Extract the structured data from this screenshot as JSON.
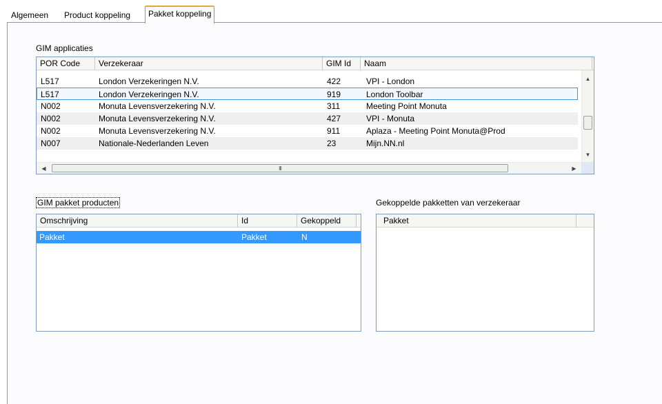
{
  "tabs": [
    {
      "label": "Algemeen"
    },
    {
      "label": "Product koppeling"
    },
    {
      "label": "Pakket koppeling"
    }
  ],
  "gim_applicaties": {
    "title": "GIM applicaties",
    "columns": [
      "POR Code",
      "Verzekeraar",
      "GIM Id",
      "Naam"
    ],
    "rows": [
      {
        "por": "L517",
        "verzekeraar": "London Verzekeringen N.V.",
        "gim_id": "422",
        "naam": "VPI - London"
      },
      {
        "por": "L517",
        "verzekeraar": "London Verzekeringen N.V.",
        "gim_id": "919",
        "naam": "London Toolbar"
      },
      {
        "por": "N002",
        "verzekeraar": "Monuta Levensverzekering N.V.",
        "gim_id": "311",
        "naam": "Meeting Point Monuta"
      },
      {
        "por": "N002",
        "verzekeraar": "Monuta Levensverzekering N.V.",
        "gim_id": "427",
        "naam": "VPI - Monuta"
      },
      {
        "por": "N002",
        "verzekeraar": "Monuta Levensverzekering N.V.",
        "gim_id": "911",
        "naam": "Aplaza - Meeting Point Monuta@Prod"
      },
      {
        "por": "N007",
        "verzekeraar": "Nationale-Nederlanden Leven",
        "gim_id": "23",
        "naam": "Mijn.NN.nl"
      }
    ],
    "hscroll_grip": "III"
  },
  "gim_pakket_producten": {
    "title": "GIM pakket producten",
    "columns": [
      "Omschrijving",
      "Id",
      "Gekoppeld"
    ],
    "rows": [
      {
        "omschrijving": "Pakket",
        "id": "Pakket",
        "gekoppeld": "N"
      }
    ]
  },
  "gekoppelde_pakketten": {
    "title": "Gekoppelde pakketten van verzekeraar",
    "columns": [
      "Pakket"
    ]
  },
  "colors": {
    "selection": "#3399ff",
    "focus_border": "#3d95d8",
    "active_tab_accent": "#e8a33a",
    "list_border": "#7f9db9"
  }
}
